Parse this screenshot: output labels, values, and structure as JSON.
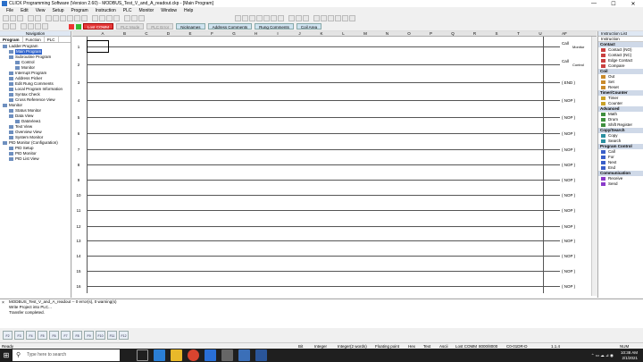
{
  "window": {
    "title": "CLICK Programming Software (Version 2.60) - MODBUS_Test_V_and_A_readout.ckp - [Main Program]",
    "min": "—",
    "max": "☐",
    "close": "✕"
  },
  "menu": [
    "File",
    "Edit",
    "View",
    "Setup",
    "Program",
    "Instruction",
    "PLC",
    "Monitor",
    "Window",
    "Help"
  ],
  "toolbar2": {
    "mode_status": "Lost COMM",
    "plc_mode": "PLC Mode",
    "plc_error": "PLC Error",
    "nicknames": "Nicknames",
    "address_comments": "Address Comments",
    "rung_comments": "Rung Comments",
    "coil_area": "Coil Area"
  },
  "navigation": {
    "header": "Navigation",
    "tabs": [
      "Program",
      "Function",
      "PLC"
    ],
    "tree": [
      {
        "label": "Ladder Program",
        "level": 0
      },
      {
        "label": "Main Program",
        "level": 1,
        "selected": true
      },
      {
        "label": "Subroutine Program",
        "level": 1
      },
      {
        "label": "Control",
        "level": 2
      },
      {
        "label": "Monitor",
        "level": 2
      },
      {
        "label": "Interrupt Program",
        "level": 1
      },
      {
        "label": "Address Picker",
        "level": 1
      },
      {
        "label": "Edit Rung Comments",
        "level": 1
      },
      {
        "label": "Local Program Information",
        "level": 1
      },
      {
        "label": "Syntax Check",
        "level": 1
      },
      {
        "label": "Cross Reference View",
        "level": 1
      },
      {
        "label": "Monitor",
        "level": 0
      },
      {
        "label": "Status Monitor",
        "level": 1
      },
      {
        "label": "Data View",
        "level": 1
      },
      {
        "label": "DataView1",
        "level": 2
      },
      {
        "label": "Text View",
        "level": 1
      },
      {
        "label": "Overview View",
        "level": 1
      },
      {
        "label": "System Monitor",
        "level": 1
      },
      {
        "label": "PID Monitor (Configuration)",
        "level": 0
      },
      {
        "label": "PID Setup",
        "level": 1
      },
      {
        "label": "PID Monitor",
        "level": 1
      },
      {
        "label": "PID List View",
        "level": 1
      }
    ]
  },
  "ladder": {
    "columns": [
      "A",
      "B",
      "C",
      "D",
      "E",
      "F",
      "G",
      "H",
      "I",
      "J",
      "K",
      "L",
      "M",
      "N",
      "O",
      "P",
      "Q",
      "R",
      "S",
      "T",
      "U",
      "AF"
    ],
    "rungs": [
      {
        "n": "1",
        "coil": "Call",
        "sub": "Monitor"
      },
      {
        "n": "2",
        "coil": "Call",
        "sub": "Control"
      },
      {
        "n": "3",
        "coil": "( END )"
      },
      {
        "n": "4",
        "coil": "( NOP )"
      },
      {
        "n": "5",
        "coil": "( NOP )"
      },
      {
        "n": "6",
        "coil": "( NOP )"
      },
      {
        "n": "7",
        "coil": "( NOP )"
      },
      {
        "n": "8",
        "coil": "( NOP )"
      },
      {
        "n": "9",
        "coil": "( NOP )"
      },
      {
        "n": "10",
        "coil": "( NOP )"
      },
      {
        "n": "11",
        "coil": "( NOP )"
      },
      {
        "n": "12",
        "coil": "( NOP )"
      },
      {
        "n": "13",
        "coil": "( NOP )"
      },
      {
        "n": "14",
        "coil": "( NOP )"
      },
      {
        "n": "15",
        "coil": "( NOP )"
      },
      {
        "n": "16",
        "coil": "( NOP )"
      }
    ]
  },
  "instruction_list": {
    "header": "Instruction List",
    "subheader": "Instruction",
    "groups": [
      {
        "name": "Contact",
        "color": "#c94040",
        "items": [
          "Contact (NO)",
          "Contact (NC)",
          "Edge Contact",
          "Compare"
        ]
      },
      {
        "name": "Coil",
        "color": "#c98a2a",
        "items": [
          "Out",
          "Set",
          "Reset"
        ]
      },
      {
        "name": "Timer/Counter",
        "color": "#c9a22a",
        "items": [
          "Timer",
          "Counter"
        ]
      },
      {
        "name": "Advanced",
        "color": "#3f8f3f",
        "items": [
          "Math",
          "Drum",
          "Shift Register"
        ]
      },
      {
        "name": "Copy/Search",
        "color": "#2a8fa0",
        "items": [
          "Copy",
          "Search"
        ]
      },
      {
        "name": "Program Control",
        "color": "#3a5fc9",
        "items": [
          "Call",
          "For",
          "Next",
          "End"
        ]
      },
      {
        "name": "Communication",
        "color": "#8a3ac9",
        "items": [
          "Receive",
          "Send"
        ]
      }
    ]
  },
  "output": {
    "lines": [
      "MODBUS_Test_V_and_A_readout -- 0 error(s), 0 warning(s)",
      "",
      "Write Project into PLC...",
      "Transfer completed."
    ]
  },
  "fkeys": [
    "F2",
    "F3",
    "F4",
    "F5",
    "F6",
    "F7",
    "F8",
    "F9",
    "F10",
    "F11",
    "F12"
  ],
  "status": {
    "ready": "Ready",
    "bit": "Bit",
    "integer": "Integer",
    "integer2": "Integer(2 words)",
    "float": "Floating point",
    "hex": "Hex",
    "text": "Text",
    "ascii": "Ascii",
    "comm": "Lost COMM",
    "baud": "8000/8000",
    "cpu": "C0-01DR-D",
    "ver": "1.1.4",
    "num": "NUM"
  },
  "taskbar": {
    "search_placeholder": "Type here to search",
    "time": "10:38 AM",
    "date": "2/1/2021"
  }
}
